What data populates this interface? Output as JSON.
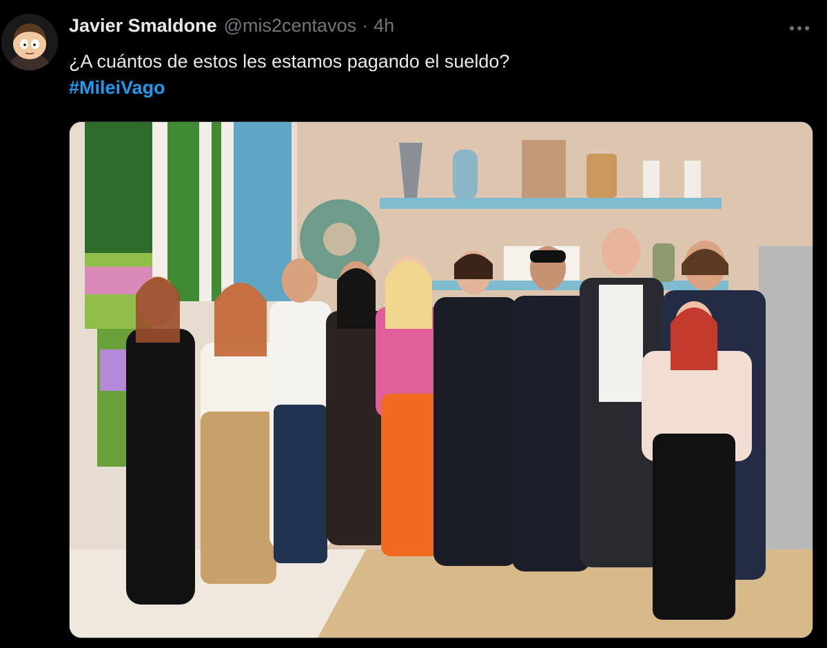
{
  "tweet": {
    "author_name": "Javier Smaldone",
    "handle": "@mis2centavos",
    "separator": "·",
    "time": "4h",
    "text": "¿A cuántos de estos les estamos pagando el sueldo?",
    "hashtag": "#MileiVago",
    "more_icon": "more-horizontal-icon",
    "avatar_icon": "cartoon-avatar-icon"
  },
  "colors": {
    "background": "#000000",
    "text": "#e7e9ea",
    "muted": "#71767b",
    "link": "#1d9bf0"
  }
}
